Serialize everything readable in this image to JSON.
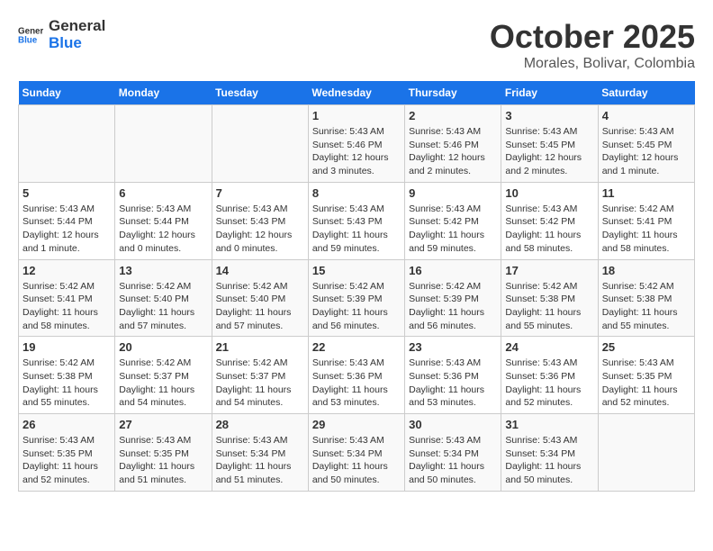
{
  "header": {
    "logo_general": "General",
    "logo_blue": "Blue",
    "month": "October 2025",
    "location": "Morales, Bolivar, Colombia"
  },
  "days_of_week": [
    "Sunday",
    "Monday",
    "Tuesday",
    "Wednesday",
    "Thursday",
    "Friday",
    "Saturday"
  ],
  "weeks": [
    {
      "days": [
        {
          "num": "",
          "info": ""
        },
        {
          "num": "",
          "info": ""
        },
        {
          "num": "",
          "info": ""
        },
        {
          "num": "1",
          "sunrise": "5:43 AM",
          "sunset": "5:46 PM",
          "daylight": "12 hours and 3 minutes."
        },
        {
          "num": "2",
          "sunrise": "5:43 AM",
          "sunset": "5:46 PM",
          "daylight": "12 hours and 2 minutes."
        },
        {
          "num": "3",
          "sunrise": "5:43 AM",
          "sunset": "5:45 PM",
          "daylight": "12 hours and 2 minutes."
        },
        {
          "num": "4",
          "sunrise": "5:43 AM",
          "sunset": "5:45 PM",
          "daylight": "12 hours and 1 minute."
        }
      ]
    },
    {
      "days": [
        {
          "num": "5",
          "sunrise": "5:43 AM",
          "sunset": "5:44 PM",
          "daylight": "12 hours and 1 minute."
        },
        {
          "num": "6",
          "sunrise": "5:43 AM",
          "sunset": "5:44 PM",
          "daylight": "12 hours and 0 minutes."
        },
        {
          "num": "7",
          "sunrise": "5:43 AM",
          "sunset": "5:43 PM",
          "daylight": "12 hours and 0 minutes."
        },
        {
          "num": "8",
          "sunrise": "5:43 AM",
          "sunset": "5:43 PM",
          "daylight": "11 hours and 59 minutes."
        },
        {
          "num": "9",
          "sunrise": "5:43 AM",
          "sunset": "5:42 PM",
          "daylight": "11 hours and 59 minutes."
        },
        {
          "num": "10",
          "sunrise": "5:43 AM",
          "sunset": "5:42 PM",
          "daylight": "11 hours and 58 minutes."
        },
        {
          "num": "11",
          "sunrise": "5:42 AM",
          "sunset": "5:41 PM",
          "daylight": "11 hours and 58 minutes."
        }
      ]
    },
    {
      "days": [
        {
          "num": "12",
          "sunrise": "5:42 AM",
          "sunset": "5:41 PM",
          "daylight": "11 hours and 58 minutes."
        },
        {
          "num": "13",
          "sunrise": "5:42 AM",
          "sunset": "5:40 PM",
          "daylight": "11 hours and 57 minutes."
        },
        {
          "num": "14",
          "sunrise": "5:42 AM",
          "sunset": "5:40 PM",
          "daylight": "11 hours and 57 minutes."
        },
        {
          "num": "15",
          "sunrise": "5:42 AM",
          "sunset": "5:39 PM",
          "daylight": "11 hours and 56 minutes."
        },
        {
          "num": "16",
          "sunrise": "5:42 AM",
          "sunset": "5:39 PM",
          "daylight": "11 hours and 56 minutes."
        },
        {
          "num": "17",
          "sunrise": "5:42 AM",
          "sunset": "5:38 PM",
          "daylight": "11 hours and 55 minutes."
        },
        {
          "num": "18",
          "sunrise": "5:42 AM",
          "sunset": "5:38 PM",
          "daylight": "11 hours and 55 minutes."
        }
      ]
    },
    {
      "days": [
        {
          "num": "19",
          "sunrise": "5:42 AM",
          "sunset": "5:38 PM",
          "daylight": "11 hours and 55 minutes."
        },
        {
          "num": "20",
          "sunrise": "5:42 AM",
          "sunset": "5:37 PM",
          "daylight": "11 hours and 54 minutes."
        },
        {
          "num": "21",
          "sunrise": "5:42 AM",
          "sunset": "5:37 PM",
          "daylight": "11 hours and 54 minutes."
        },
        {
          "num": "22",
          "sunrise": "5:43 AM",
          "sunset": "5:36 PM",
          "daylight": "11 hours and 53 minutes."
        },
        {
          "num": "23",
          "sunrise": "5:43 AM",
          "sunset": "5:36 PM",
          "daylight": "11 hours and 53 minutes."
        },
        {
          "num": "24",
          "sunrise": "5:43 AM",
          "sunset": "5:36 PM",
          "daylight": "11 hours and 52 minutes."
        },
        {
          "num": "25",
          "sunrise": "5:43 AM",
          "sunset": "5:35 PM",
          "daylight": "11 hours and 52 minutes."
        }
      ]
    },
    {
      "days": [
        {
          "num": "26",
          "sunrise": "5:43 AM",
          "sunset": "5:35 PM",
          "daylight": "11 hours and 52 minutes."
        },
        {
          "num": "27",
          "sunrise": "5:43 AM",
          "sunset": "5:35 PM",
          "daylight": "11 hours and 51 minutes."
        },
        {
          "num": "28",
          "sunrise": "5:43 AM",
          "sunset": "5:34 PM",
          "daylight": "11 hours and 51 minutes."
        },
        {
          "num": "29",
          "sunrise": "5:43 AM",
          "sunset": "5:34 PM",
          "daylight": "11 hours and 50 minutes."
        },
        {
          "num": "30",
          "sunrise": "5:43 AM",
          "sunset": "5:34 PM",
          "daylight": "11 hours and 50 minutes."
        },
        {
          "num": "31",
          "sunrise": "5:43 AM",
          "sunset": "5:34 PM",
          "daylight": "11 hours and 50 minutes."
        },
        {
          "num": "",
          "info": ""
        }
      ]
    }
  ],
  "labels": {
    "sunrise": "Sunrise:",
    "sunset": "Sunset:",
    "daylight": "Daylight:"
  }
}
